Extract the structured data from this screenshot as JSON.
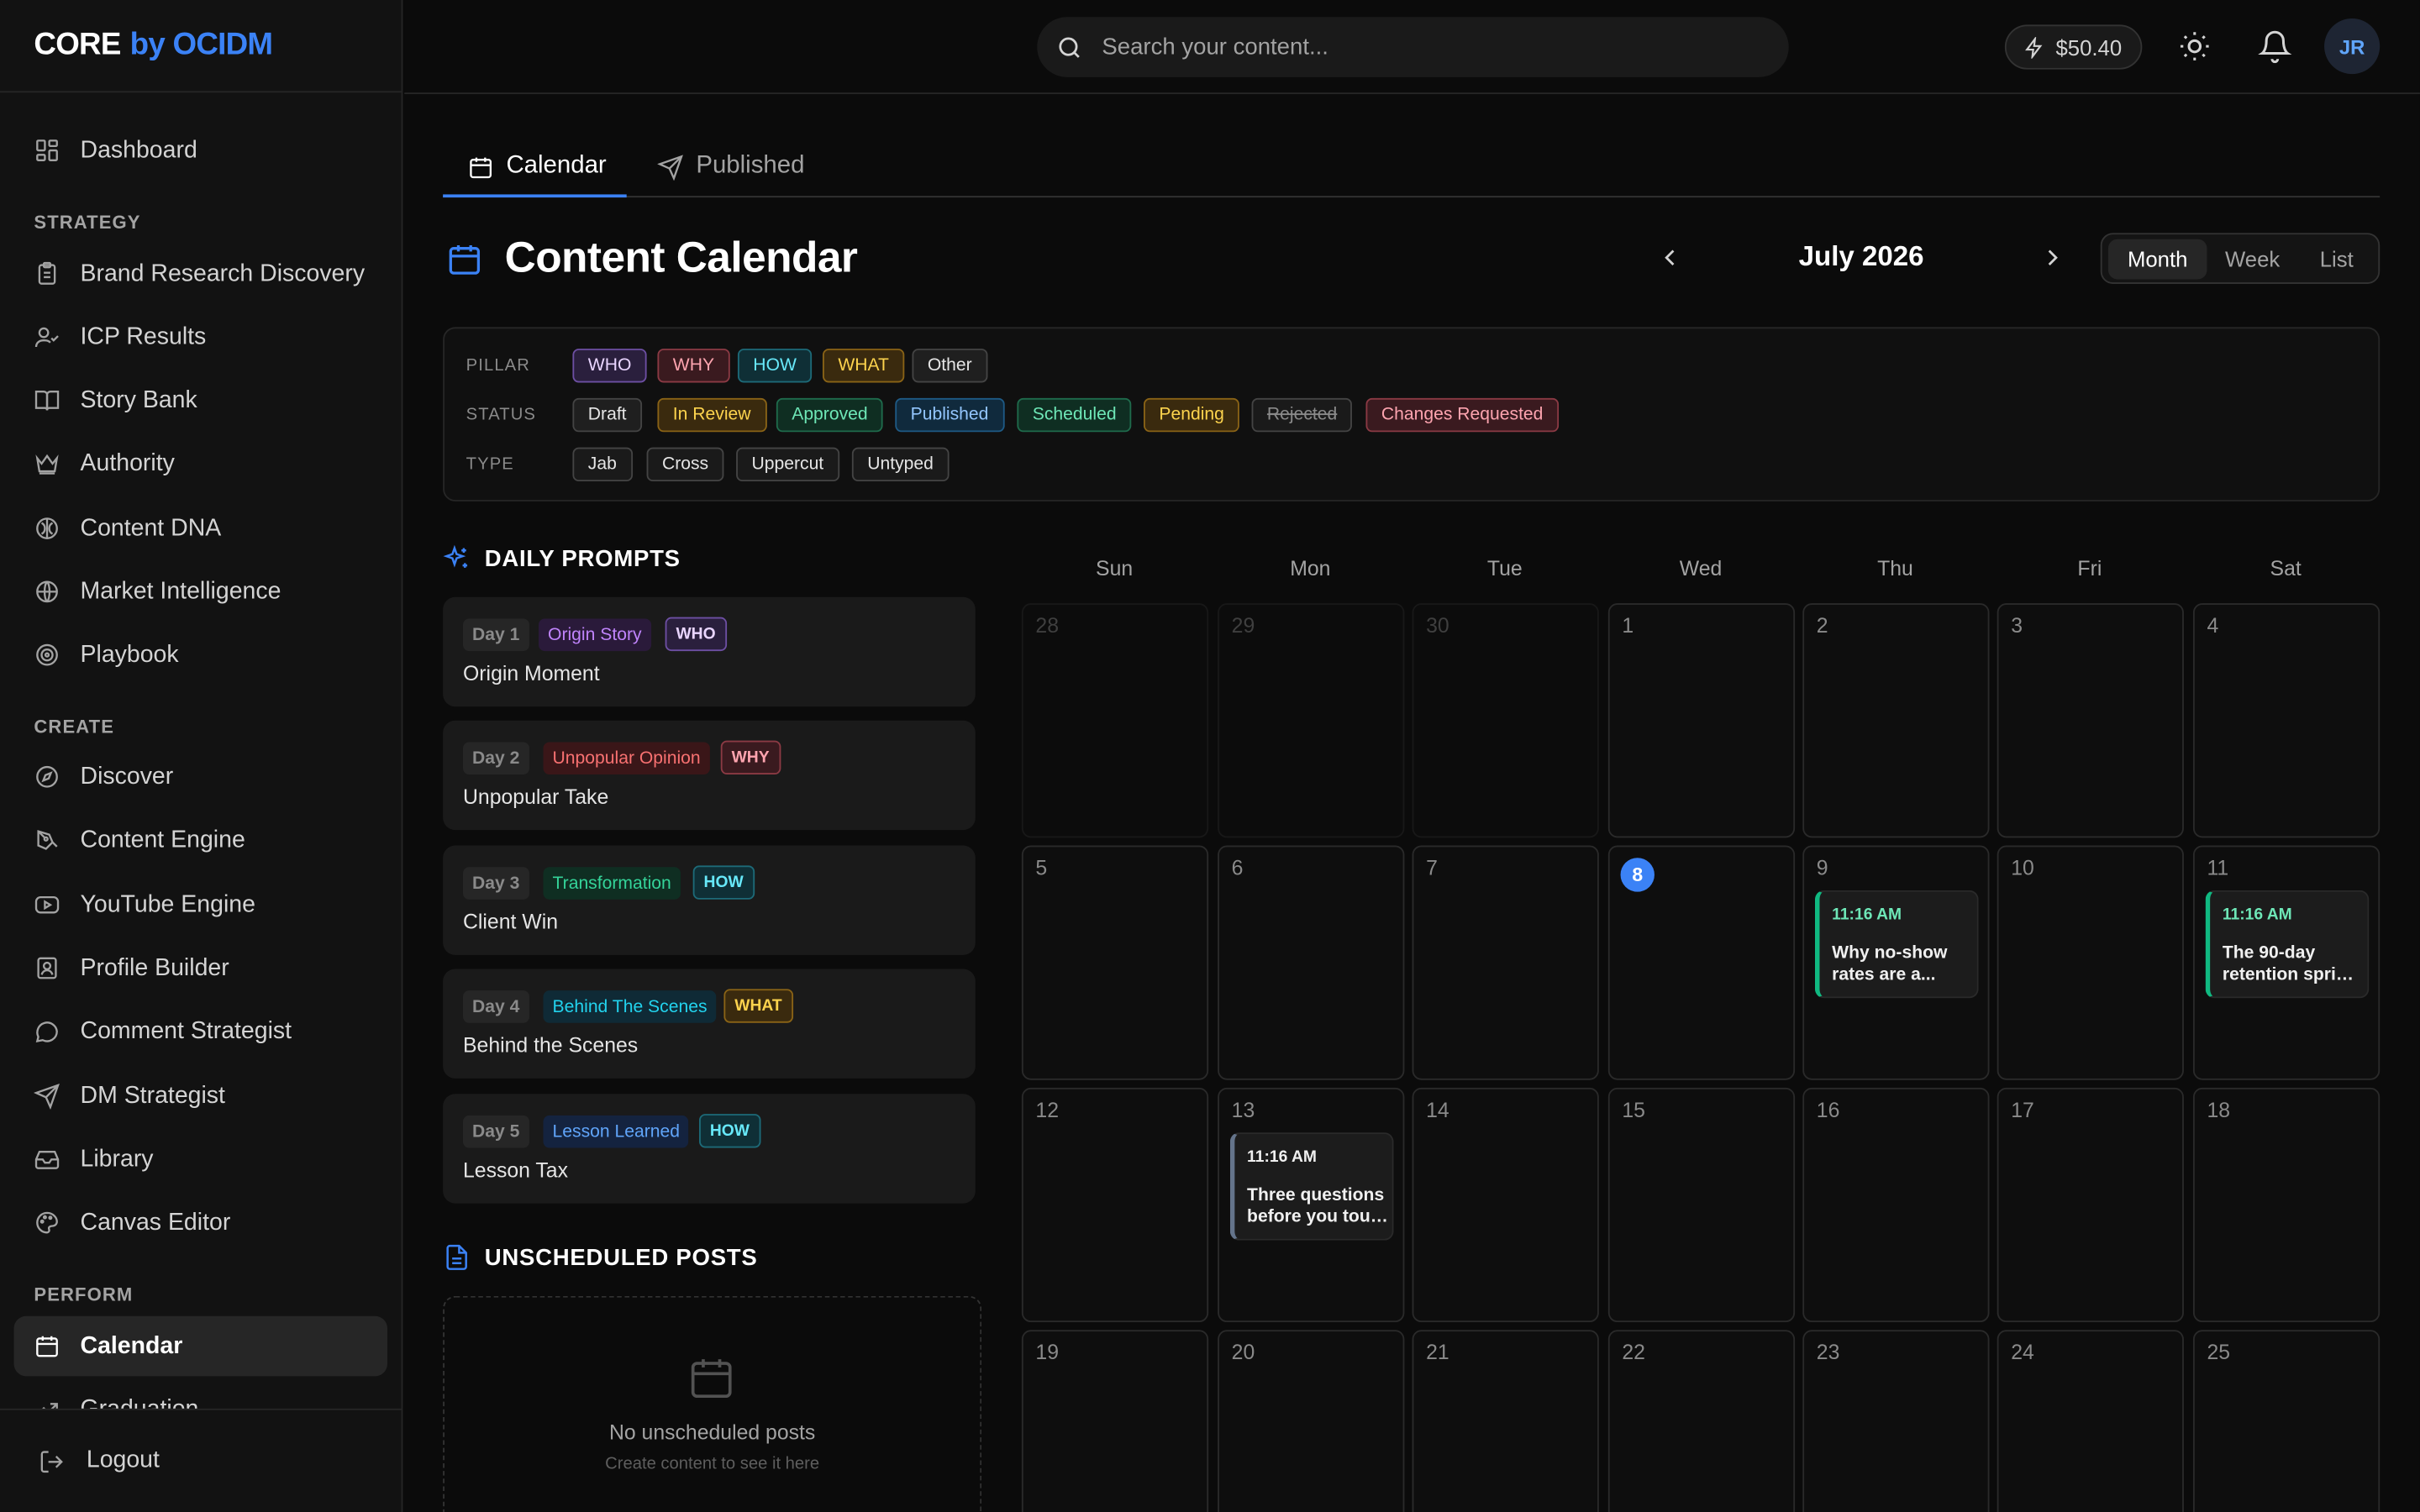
{
  "brand": {
    "name": "CORE",
    "by": "by OCIDM"
  },
  "sidebar": {
    "dashboard": "Dashboard",
    "sections": [
      "STRATEGY",
      "CREATE",
      "PERFORM"
    ],
    "strategy": [
      "Brand Research Discovery",
      "ICP Results",
      "Story Bank",
      "Authority",
      "Content DNA",
      "Market Intelligence",
      "Playbook"
    ],
    "create": [
      "Discover",
      "Content Engine",
      "YouTube Engine",
      "Profile Builder",
      "Comment Strategist",
      "DM Strategist",
      "Library",
      "Canvas Editor"
    ],
    "perform": [
      "Calendar",
      "Graduation"
    ],
    "logout": "Logout"
  },
  "header": {
    "search_placeholder": "Search your content...",
    "credits": "$50.40",
    "avatar": "JR"
  },
  "tabs": [
    "Calendar",
    "Published"
  ],
  "page": {
    "title": "Content Calendar",
    "month": "July 2026",
    "views": [
      "Month",
      "Week",
      "List"
    ]
  },
  "filters": {
    "pillar_label": "PILLAR",
    "pillar": [
      "WHO",
      "WHY",
      "HOW",
      "WHAT",
      "Other"
    ],
    "status_label": "STATUS",
    "status": [
      "Draft",
      "In Review",
      "Approved",
      "Published",
      "Scheduled",
      "Pending",
      "Rejected",
      "Changes Requested"
    ],
    "type_label": "TYPE",
    "type": [
      "Jab",
      "Cross",
      "Uppercut",
      "Untyped"
    ]
  },
  "daily_prompts": {
    "title": "DAILY PROMPTS",
    "items": [
      {
        "day": "Day 1",
        "tag": "Origin Story",
        "pillar": "WHO",
        "title": "Origin Moment"
      },
      {
        "day": "Day 2",
        "tag": "Unpopular Opinion",
        "pillar": "WHY",
        "title": "Unpopular Take"
      },
      {
        "day": "Day 3",
        "tag": "Transformation",
        "pillar": "HOW",
        "title": "Client Win"
      },
      {
        "day": "Day 4",
        "tag": "Behind The Scenes",
        "pillar": "WHAT",
        "title": "Behind the Scenes"
      },
      {
        "day": "Day 5",
        "tag": "Lesson Learned",
        "pillar": "HOW",
        "title": "Lesson Tax"
      }
    ]
  },
  "unscheduled": {
    "title": "UNSCHEDULED POSTS",
    "empty": "No unscheduled posts",
    "hint": "Create content to see it here"
  },
  "calendar": {
    "weekdays": [
      "Sun",
      "Mon",
      "Tue",
      "Wed",
      "Thu",
      "Fri",
      "Sat"
    ],
    "weeks": [
      [
        "28",
        "29",
        "30",
        "1",
        "2",
        "3",
        "4"
      ],
      [
        "5",
        "6",
        "7",
        "8",
        "9",
        "10",
        "11"
      ],
      [
        "12",
        "13",
        "14",
        "15",
        "16",
        "17",
        "18"
      ],
      [
        "19",
        "20",
        "21",
        "22",
        "23",
        "24",
        "25"
      ]
    ],
    "today": "8",
    "events": [
      {
        "day": "9",
        "time": "11:16 AM",
        "title_l1": "Why no-show",
        "title_l2": "rates are a...",
        "color": "#10b981"
      },
      {
        "day": "11",
        "time": "11:16 AM",
        "title_l1": "The 90-day",
        "title_l2": "retention sprint...",
        "color": "#10b981"
      },
      {
        "day": "13",
        "time": "11:16 AM",
        "title_l1": "Three questions",
        "title_l2": "before you touc...",
        "color": "#64748b"
      }
    ]
  }
}
